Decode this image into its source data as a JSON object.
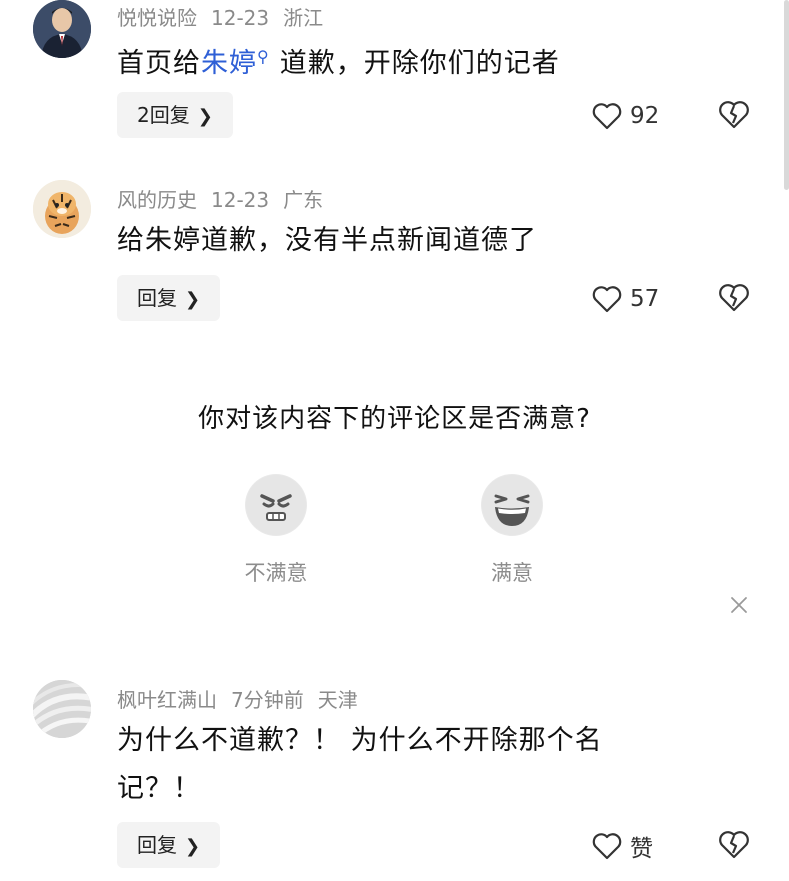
{
  "comments": [
    {
      "user": "悦悦说险",
      "date": "12-23",
      "region": "浙江",
      "text_before": "首页给",
      "mention": "朱婷",
      "text_after": "道歉，开除你们的记者",
      "reply_label": "2回复",
      "likes": "92"
    },
    {
      "user": "风的历史",
      "date": "12-23",
      "region": "广东",
      "text": "给朱婷道歉，没有半点新闻道德了",
      "reply_label": "回复",
      "likes": "57"
    },
    {
      "user": "枫叶红满山",
      "date": "7分钟前",
      "region": "天津",
      "text_line1": "为什么不道歉？！ 为什么不开除那个名",
      "text_line2": "记？！",
      "reply_label": "回复",
      "likes": "赞"
    }
  ],
  "survey": {
    "question": "你对该内容下的评论区是否满意?",
    "options": [
      {
        "label": "不满意",
        "icon": "unhappy-face-icon"
      },
      {
        "label": "满意",
        "icon": "laughing-face-icon"
      }
    ],
    "close_icon": "close-icon"
  },
  "colors": {
    "mention": "#2e5fd6",
    "meta": "#8a8a8a",
    "reply_bg": "#f3f3f3"
  }
}
